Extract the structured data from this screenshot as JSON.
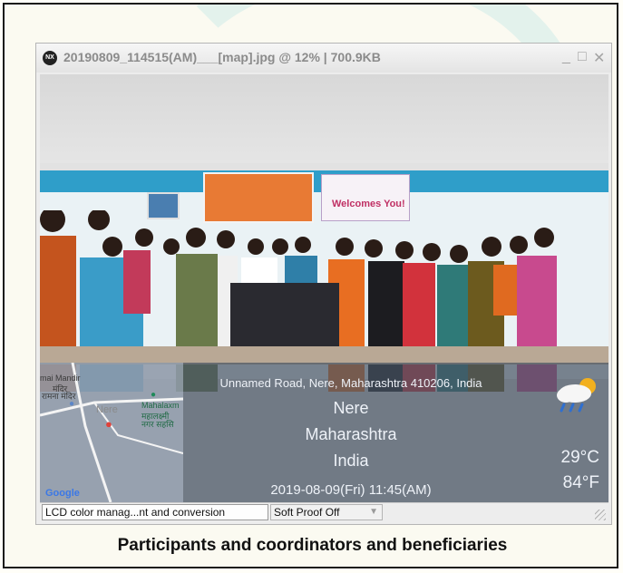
{
  "window": {
    "title": "20190809_114515(AM)___[map].jpg  @  12%  |  700.9KB",
    "app_logo_text": "NX",
    "controls": {
      "minimize": "_",
      "maximize": "□",
      "close": "✕"
    }
  },
  "photo": {
    "banner_text": "Welcomes You!",
    "overlay": {
      "address": "Unnamed Road, Nere, Maharashtra 410206, India",
      "city": "Nere",
      "state": "Maharashtra",
      "country": "India",
      "timestamp": "2019-08-09(Fri)   11:45(AM)",
      "temp_c": "29°C",
      "temp_f": "84°F",
      "weather_icon": "rain-cloud-sun-icon"
    },
    "map": {
      "labels": [
        "mai Mandir",
        "मंदिर",
        "रामना मंदिर",
        "Nere",
        "Mahalaxm",
        "महालक्ष्मी",
        "नगर सहसि"
      ],
      "attribution": "Google"
    }
  },
  "statusbar": {
    "color_management": "LCD color manag...nt and conversion",
    "soft_proof": "Soft Proof Off"
  },
  "caption": "Participants and coordinators and beneficiaries"
}
